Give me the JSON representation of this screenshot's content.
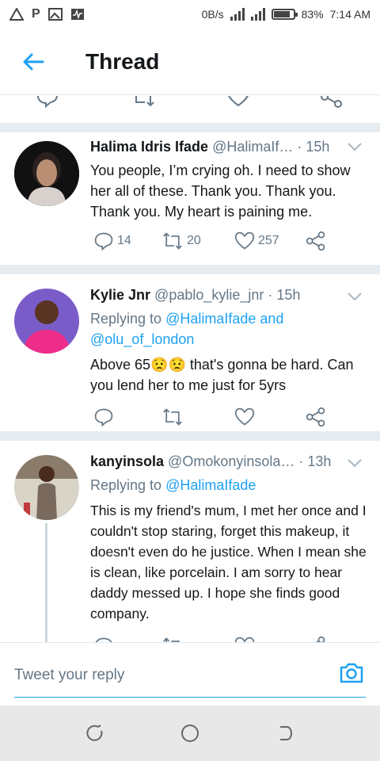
{
  "status_bar": {
    "icons_left": [
      "triangle-icon",
      "parking-icon",
      "gallery-icon",
      "pulse-icon"
    ],
    "speed": "0B/s",
    "battery": "83%",
    "time": "7:14 AM"
  },
  "header": {
    "title": "Thread",
    "back_icon": "arrow-left-icon"
  },
  "tweets": [
    {
      "name": "Halima Idris Ifade",
      "handle": "@HalimaIf…",
      "time": "· 15h",
      "text": "You people, I’m crying oh. I need to show her all of these. Thank you. Thank you. Thank you. My heart is paining me.",
      "replies": "14",
      "retweets": "20",
      "likes": "257"
    },
    {
      "name": "Kylie Jnr",
      "handle": "@pablo_kylie_jnr",
      "time": "· 15h",
      "replying_prefix": "Replying to",
      "replying_to": "@HalimaIfade and @olu_of_london",
      "text": "Above 65😟😟 that's gonna be hard. Can you lend her to me just for 5yrs"
    },
    {
      "name": "kanyinsola",
      "handle": "@Omokonyinsola…",
      "time": "· 13h",
      "replying_prefix": "Replying to",
      "replying_to": "@HalimaIfade",
      "text": "This is my friend's mum, I met her once and I couldn't stop staring, forget this makeup, it doesn't even do he justice. When I mean she is clean, like porcelain. I am sorry to hear daddy messed up. I hope she finds good company."
    }
  ],
  "reply_bar": {
    "placeholder": "Tweet your reply",
    "camera_icon": "camera-icon"
  },
  "colors": {
    "accent": "#1da1f2",
    "muted": "#657786",
    "divider": "#e6ecf0"
  }
}
